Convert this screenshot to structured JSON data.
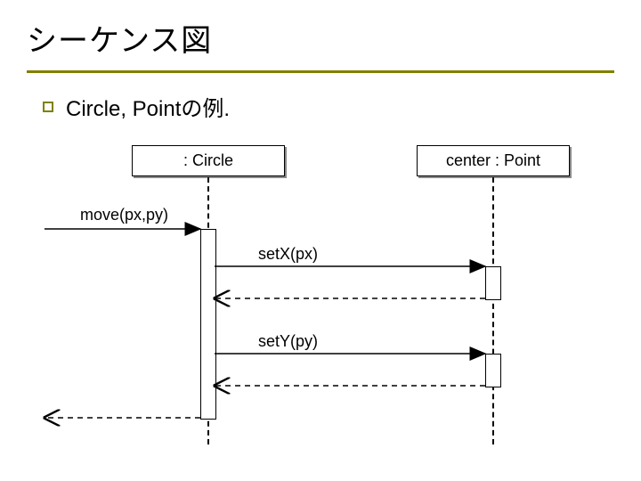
{
  "title": "シーケンス図",
  "bullet": "Circle, Pointの例.",
  "objects": {
    "circle": {
      "label": ": Circle"
    },
    "point": {
      "label": "center : Point"
    }
  },
  "messages": {
    "move": {
      "label": "move(px,py)"
    },
    "setx": {
      "label": "setX(px)"
    },
    "sety": {
      "label": "setY(py)"
    }
  }
}
